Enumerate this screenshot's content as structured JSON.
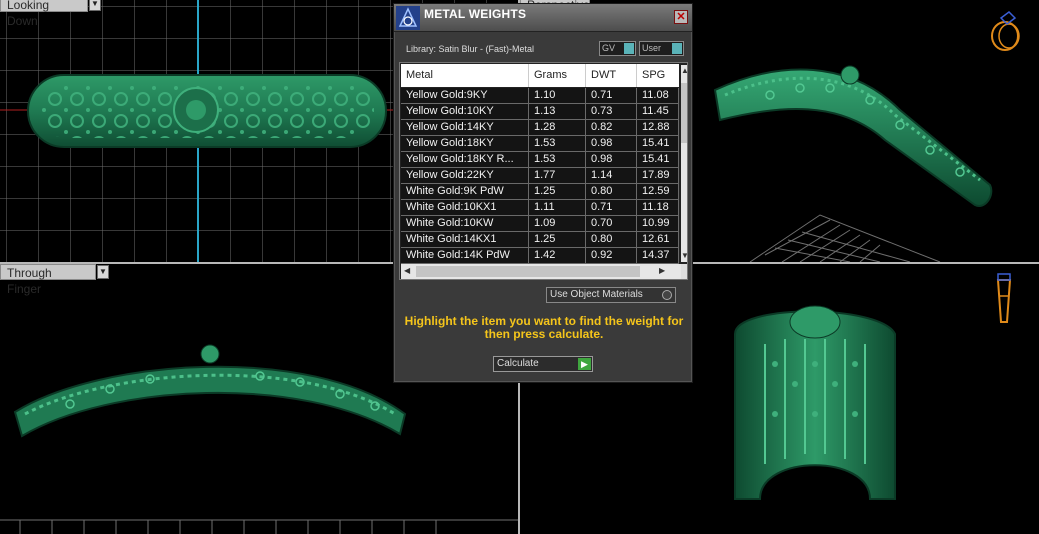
{
  "viewports": {
    "top_label": "Looking Down",
    "perspective_label": "Perspective",
    "finger_label": "Through Finger"
  },
  "dialog": {
    "title": "METAL WEIGHTS",
    "library": "Library: Satin Blur - (Fast)-Metal",
    "toggle_gv": "GV",
    "toggle_user": "User",
    "columns": [
      "Metal",
      "Grams",
      "DWT",
      "SPG"
    ],
    "rows": [
      {
        "metal": "Yellow Gold:9KY",
        "grams": "1.10",
        "dwt": "0.71",
        "spg": "11.08"
      },
      {
        "metal": "Yellow Gold:10KY",
        "grams": "1.13",
        "dwt": "0.73",
        "spg": "11.45"
      },
      {
        "metal": "Yellow Gold:14KY",
        "grams": "1.28",
        "dwt": "0.82",
        "spg": "12.88"
      },
      {
        "metal": "Yellow Gold:18KY",
        "grams": "1.53",
        "dwt": "0.98",
        "spg": "15.41"
      },
      {
        "metal": "Yellow Gold:18KY R...",
        "grams": "1.53",
        "dwt": "0.98",
        "spg": "15.41"
      },
      {
        "metal": "Yellow Gold:22KY",
        "grams": "1.77",
        "dwt": "1.14",
        "spg": "17.89"
      },
      {
        "metal": "White Gold:9K PdW",
        "grams": "1.25",
        "dwt": "0.80",
        "spg": "12.59"
      },
      {
        "metal": "White Gold:10KX1",
        "grams": "1.11",
        "dwt": "0.71",
        "spg": "11.18"
      },
      {
        "metal": "White Gold:10KW",
        "grams": "1.09",
        "dwt": "0.70",
        "spg": "10.99"
      },
      {
        "metal": "White Gold:14KX1",
        "grams": "1.25",
        "dwt": "0.80",
        "spg": "12.61"
      },
      {
        "metal": "White Gold:14K PdW",
        "grams": "1.42",
        "dwt": "0.92",
        "spg": "14.37"
      }
    ],
    "use_object_materials": "Use Object Materials",
    "instruction": "Highlight the item you want to find the weight for then press calculate.",
    "calculate": "Calculate"
  },
  "colors": {
    "model_green": "#1f7a52",
    "model_highlight": "#3fb07c",
    "instruction_text": "#f5c51b",
    "grid_line": "#7a7a7a",
    "axis_cyan": "#2aa6c8",
    "axis_red": "#b02020",
    "gizmo_orange": "#e08a1a",
    "gizmo_blue": "#3a5fd6"
  },
  "icons": [
    "dialog-logo-icon",
    "close-icon",
    "ring-orientation-icon",
    "finger-orientation-icon",
    "dropdown-arrow-icon",
    "scroll-up-icon",
    "scroll-down-icon",
    "scroll-left-icon",
    "scroll-right-icon",
    "play-icon"
  ]
}
